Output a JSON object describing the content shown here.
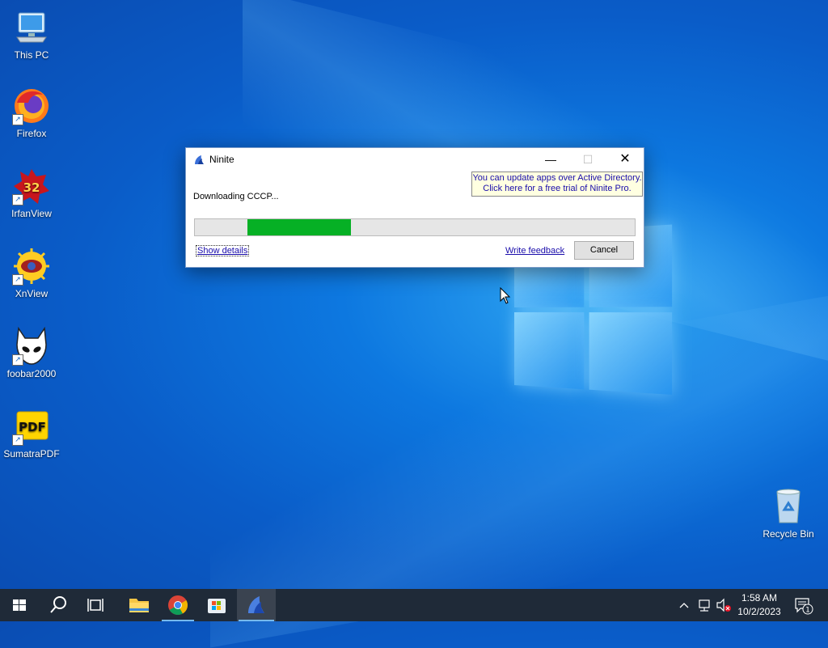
{
  "desktop": {
    "icons": [
      {
        "label": "This PC"
      },
      {
        "label": "Firefox"
      },
      {
        "label": "IrfanView"
      },
      {
        "label": "XnView"
      },
      {
        "label": "foobar2000"
      },
      {
        "label": "SumatraPDF"
      },
      {
        "label": "Recycle Bin"
      }
    ]
  },
  "dialog": {
    "title": "Ninite",
    "ad_line1": "You can update apps over Active Directory.",
    "ad_line2": "Click here for a free trial of Ninite Pro.",
    "status": "Downloading CCCP...",
    "progress": {
      "start": 0.12,
      "end": 0.355
    },
    "show_details": "Show details",
    "write_feedback": "Write feedback",
    "cancel": "Cancel"
  },
  "taskbar": {
    "time": "1:58 AM",
    "date": "10/2/2023",
    "notification_count": "1"
  },
  "colors": {
    "progress_fill": "#06b025",
    "link": "#1a0dab",
    "taskbar": "#1f2a38"
  }
}
